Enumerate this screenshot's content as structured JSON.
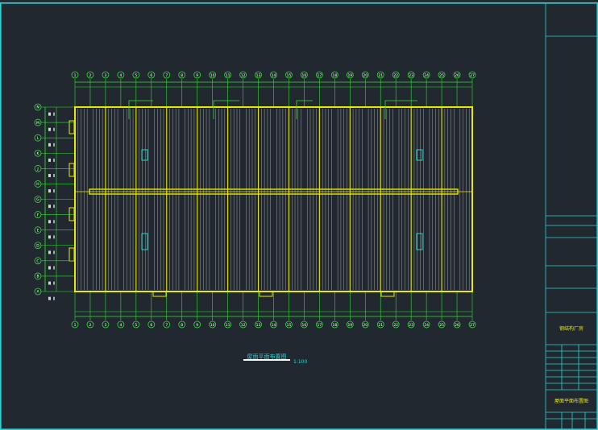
{
  "drawing": {
    "title": "屋面平面布置图",
    "scale": "1:100",
    "colors": {
      "background": "#212830",
      "frame": "#27d3d3",
      "grid": "#2ee02e",
      "roof": "#e8e800",
      "roof_lines": "#c8c8c8",
      "text": "#ffffff",
      "highlight": "#e8e800"
    },
    "axis_labels_top": [
      "1",
      "2",
      "3",
      "4",
      "5",
      "6",
      "7",
      "8",
      "9",
      "10",
      "11",
      "12",
      "13",
      "14",
      "15",
      "16",
      "17",
      "18",
      "19",
      "20",
      "21",
      "22",
      "23",
      "24",
      "25",
      "26",
      "27"
    ],
    "axis_labels_side": [
      "N",
      "M",
      "L",
      "K",
      "J",
      "H",
      "G",
      "F",
      "E",
      "D",
      "C",
      "B",
      "A"
    ]
  },
  "title_block": {
    "project_name": "钢结构厂房",
    "drawing_name": "屋面平面布置图"
  }
}
